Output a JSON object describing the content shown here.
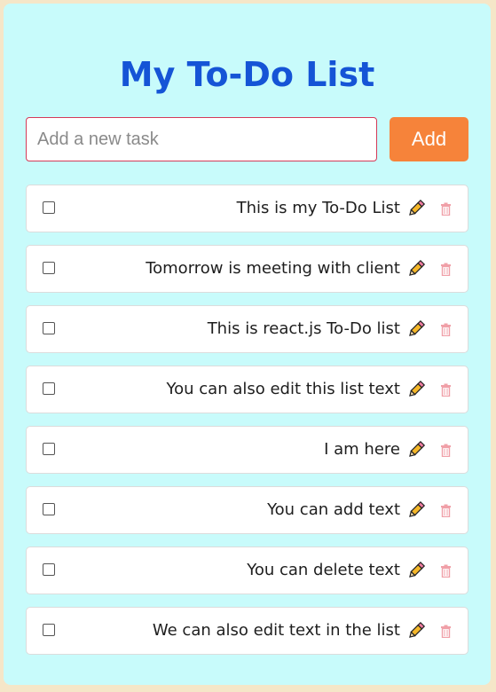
{
  "header": {
    "title": "My To-Do List"
  },
  "new_task": {
    "placeholder": "Add a new task",
    "value": "",
    "add_label": "Add"
  },
  "tasks": [
    {
      "text": "This is my To-Do List",
      "checked": false
    },
    {
      "text": "Tomorrow is meeting with client",
      "checked": false
    },
    {
      "text": "This is react.js To-Do list",
      "checked": false
    },
    {
      "text": "You can also edit this list text",
      "checked": false
    },
    {
      "text": "I am here",
      "checked": false
    },
    {
      "text": "You can add text ",
      "checked": false
    },
    {
      "text": "You can delete text ",
      "checked": false
    },
    {
      "text": "We can also edit text in the list",
      "checked": false
    }
  ],
  "icons": {
    "edit": "pencil-icon",
    "delete": "trash-icon"
  },
  "colors": {
    "page_background": "#f5e6c8",
    "card_background": "#c8fbfb",
    "title": "#1554d6",
    "add_button": "#f6833a",
    "input_border": "#d43a58",
    "delete_icon": "#f0a0a8"
  }
}
